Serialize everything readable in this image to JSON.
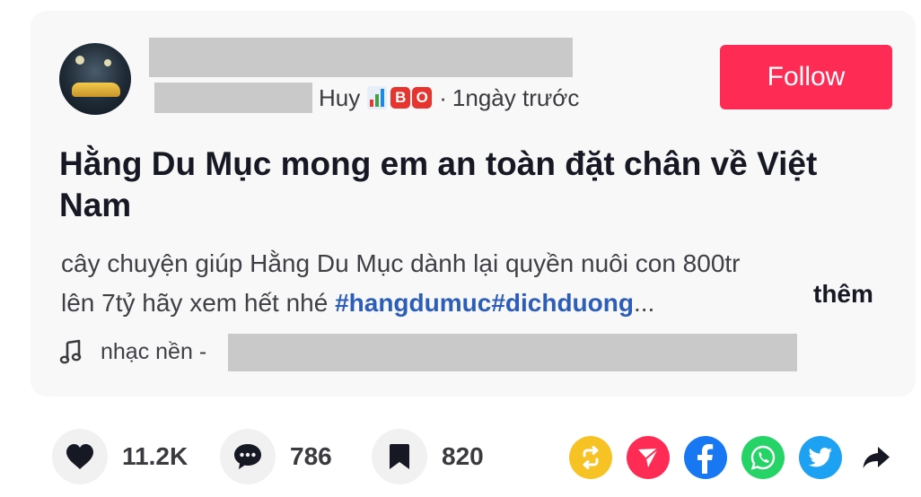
{
  "author": {
    "display_name_suffix": "Huy",
    "badge_letters": [
      "B",
      "O"
    ],
    "separator": "·",
    "time_ago": "1ngày trước",
    "follow_label": "Follow"
  },
  "post": {
    "title": "Hằng Du Mục mong em an toàn đặt chân về Việt Nam",
    "description_line1": "cây chuyện giúp Hằng Du Mục dành lại quyền nuôi con 800tr",
    "description_line2_text": "lên 7tỷ hãy xem hết nhé ",
    "hashtags": "#hangdumuc#dichduong",
    "ellipsis": "...",
    "more_label": "thêm",
    "music_prefix": "nhạc nền -"
  },
  "actions": {
    "likes": "11.2K",
    "comments": "786",
    "saves": "820"
  },
  "colors": {
    "follow_bg": "#fe2c55",
    "hashtag": "#2b5db9",
    "repost": "#f7c223",
    "send": "#fe2c55",
    "facebook": "#1877f2",
    "whatsapp": "#25d366",
    "twitter": "#1da1f2"
  },
  "icons": [
    "heart-icon",
    "comment-icon",
    "bookmark-icon",
    "repost-icon",
    "send-icon",
    "facebook-icon",
    "whatsapp-icon",
    "twitter-icon",
    "share-arrow-icon",
    "music-note-icon"
  ]
}
